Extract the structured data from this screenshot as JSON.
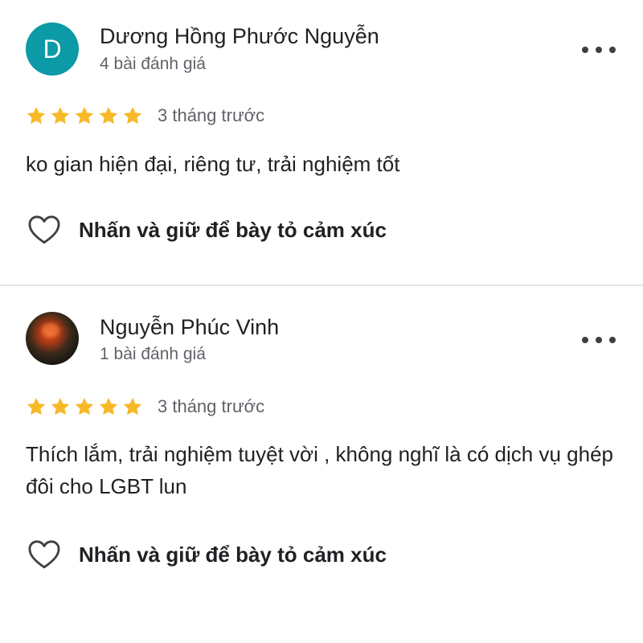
{
  "reviews": [
    {
      "avatar_letter": "D",
      "avatar_color": "#0b9aa6",
      "reviewer_name": "Dương Hồng Phước Nguyễn",
      "review_count": "4 bài đánh giá",
      "rating": 5,
      "time_ago": "3 tháng trước",
      "text": "ko gian hiện đại, riêng tư, trải nghiệm tốt",
      "reaction_label": "Nhấn và giữ để bày tỏ cảm xúc"
    },
    {
      "avatar_letter": "",
      "reviewer_name": "Nguyễn Phúc Vinh",
      "review_count": "1 bài đánh giá",
      "rating": 5,
      "time_ago": "3 tháng trước",
      "text": "Thích lắm, trải nghiệm tuyệt vời , không nghĩ là có dịch vụ ghép đôi cho LGBT lun",
      "reaction_label": "Nhấn và giữ để bày tỏ cảm xúc"
    }
  ],
  "colors": {
    "star": "#f7b928",
    "text_primary": "#202124",
    "text_secondary": "#5f6368",
    "divider": "#e3e3e3"
  },
  "icons": {
    "star": "star-icon",
    "more": "more-horizontal-icon",
    "reaction": "heart-outline-icon"
  }
}
